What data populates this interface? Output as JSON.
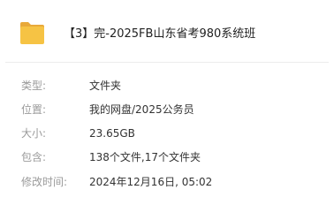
{
  "header": {
    "title": "【3】完-2025FB山东省考980系统班",
    "icon": "folder-icon",
    "icon_color": "#F6C344"
  },
  "details": [
    {
      "key": "type",
      "label": "类型:",
      "value": "文件夹"
    },
    {
      "key": "location",
      "label": "位置:",
      "value": "我的网盘/2025公务员"
    },
    {
      "key": "size",
      "label": "大小:",
      "value": "23.65GB"
    },
    {
      "key": "contains",
      "label": "包含:",
      "value": "138个文件,17个文件夹"
    },
    {
      "key": "modified",
      "label": "修改时间:",
      "value": "2024年12月16日, 05:02"
    }
  ]
}
